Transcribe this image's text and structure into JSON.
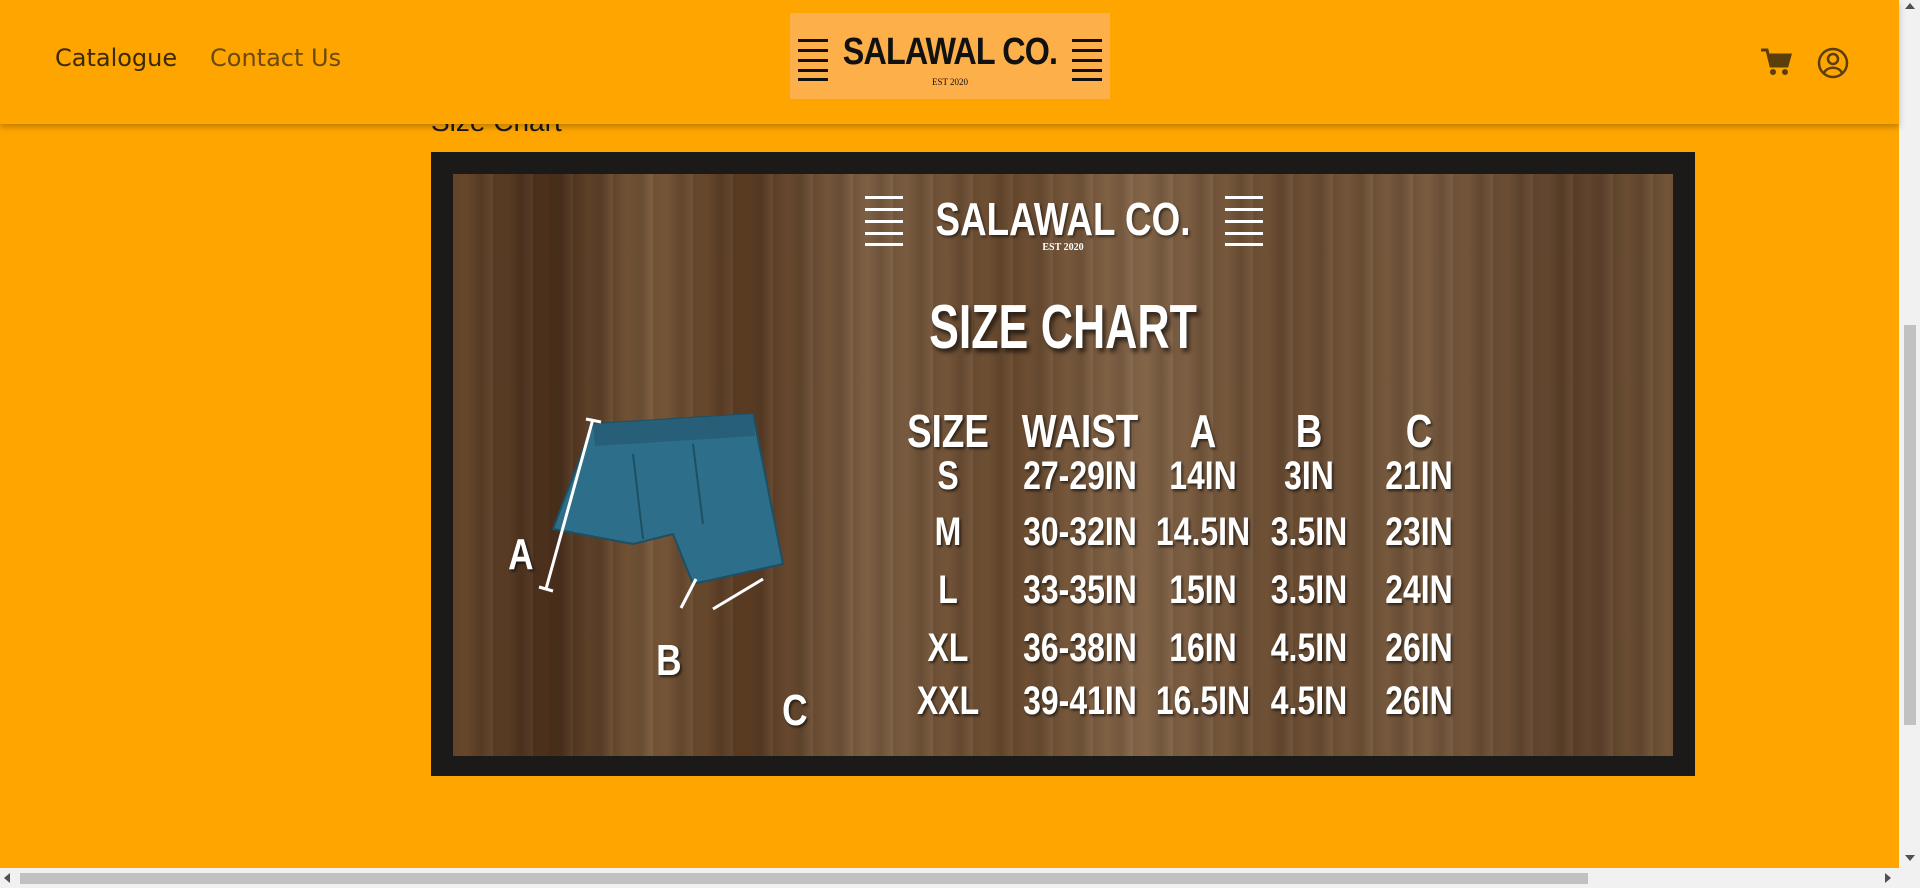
{
  "nav": {
    "catalogue": "Catalogue",
    "contact": "Contact Us"
  },
  "logo": {
    "text": "SALAWAL CO.",
    "est": "EST 2020"
  },
  "icons": {
    "cart": "shopping-cart-icon",
    "account": "user-circle-icon",
    "menu": "hamburger-icon"
  },
  "main": {
    "section_title": "Size Chart"
  },
  "size_chart": {
    "brand": "SALAWAL CO.",
    "est": "EST 2020",
    "title": "SIZE CHART",
    "headers": [
      "SIZE",
      "WAIST",
      "A",
      "B",
      "C"
    ],
    "rows": [
      [
        "S",
        "27-29IN",
        "14IN",
        "3IN",
        "21IN"
      ],
      [
        "M",
        "30-32IN",
        "14.5IN",
        "3.5IN",
        "23IN"
      ],
      [
        "L",
        "33-35IN",
        "15IN",
        "3.5IN",
        "24IN"
      ],
      [
        "XL",
        "36-38IN",
        "16IN",
        "4.5IN",
        "26IN"
      ],
      [
        "XXL",
        "39-41IN",
        "16.5IN",
        "4.5IN",
        "26IN"
      ]
    ],
    "dimension_labels": {
      "a": "A",
      "b": "B",
      "c": "C"
    }
  },
  "colors": {
    "background": "#ffa500",
    "logo_bg": "#fdaf4a",
    "shorts": "#2d6f8a"
  }
}
